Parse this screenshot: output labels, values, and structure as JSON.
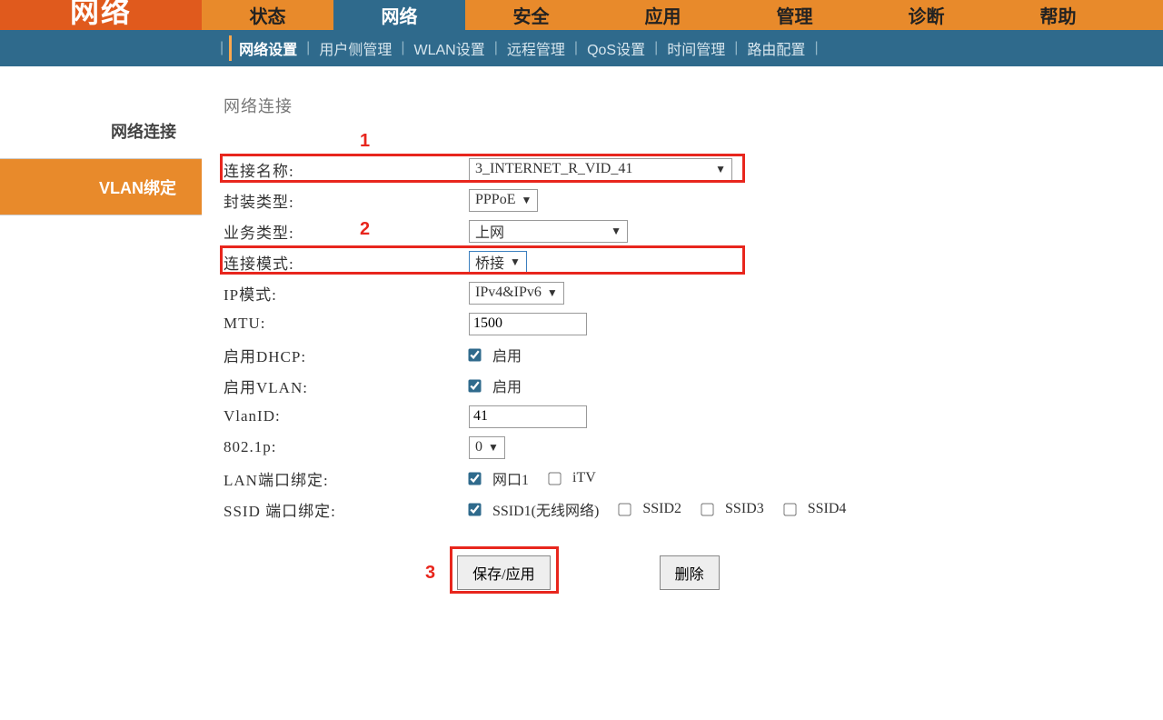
{
  "logo_text": "网络",
  "mainnav": {
    "items": [
      {
        "label": "状态"
      },
      {
        "label": "网络"
      },
      {
        "label": "安全"
      },
      {
        "label": "应用"
      },
      {
        "label": "管理"
      },
      {
        "label": "诊断"
      },
      {
        "label": "帮助"
      }
    ],
    "active_index": 1
  },
  "subnav": {
    "items": [
      {
        "label": "网络设置"
      },
      {
        "label": "用户侧管理"
      },
      {
        "label": "WLAN设置"
      },
      {
        "label": "远程管理"
      },
      {
        "label": "QoS设置"
      },
      {
        "label": "时间管理"
      },
      {
        "label": "路由配置"
      }
    ],
    "active_index": 0
  },
  "sidebar": {
    "items": [
      {
        "label": "网络连接"
      },
      {
        "label": "VLAN绑定"
      }
    ],
    "active_index": 1
  },
  "page": {
    "title": "网络连接",
    "labels": {
      "conn_name": "连接名称:",
      "encap_type": "封装类型:",
      "service_type": "业务类型:",
      "conn_mode": "连接模式:",
      "ip_mode": "IP模式:",
      "mtu": "MTU:",
      "dhcp_enable": "启用DHCP:",
      "vlan_enable": "启用VLAN:",
      "vlan_id": "VlanID:",
      "p8021": "802.1p:",
      "lan_bind": "LAN端口绑定:",
      "ssid_bind": "SSID 端口绑定:"
    },
    "values": {
      "conn_name": "3_INTERNET_R_VID_41",
      "encap_type": "PPPoE",
      "service_type": "上网",
      "conn_mode": "桥接",
      "ip_mode": "IPv4&IPv6",
      "mtu": "1500",
      "vlan_id": "41",
      "p8021": "0",
      "enable_text": "启用",
      "lan_port1": "网口1",
      "lan_itv": "iTV",
      "ssid1": "SSID1(无线网络)",
      "ssid2": "SSID2",
      "ssid3": "SSID3",
      "ssid4": "SSID4"
    },
    "buttons": {
      "save": "保存/应用",
      "delete": "删除"
    }
  },
  "annotations": {
    "n1": "1",
    "n2": "2",
    "n3": "3"
  }
}
